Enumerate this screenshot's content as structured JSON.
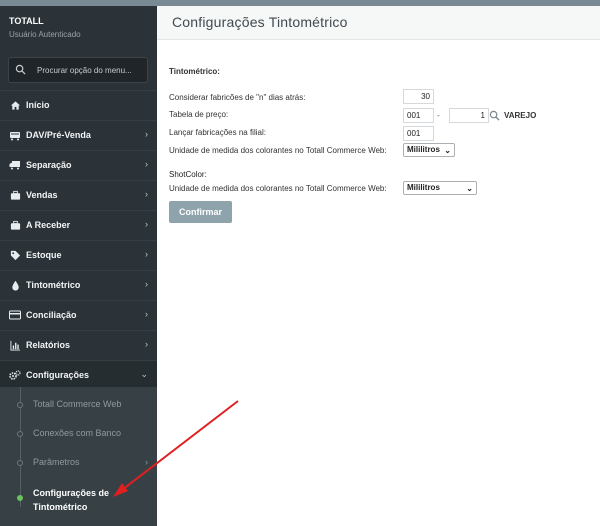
{
  "sidebar": {
    "brand": "TOTALL",
    "user_status": "Usuário Autenticado",
    "search_placeholder": "Procurar opção do menu...",
    "items": [
      {
        "label": "Início",
        "icon": "home-icon",
        "chevron": false
      },
      {
        "label": "DAV/Pré-Venda",
        "icon": "cart-icon",
        "chevron": true
      },
      {
        "label": "Separação",
        "icon": "truck-icon",
        "chevron": true
      },
      {
        "label": "Vendas",
        "icon": "briefcase-icon",
        "chevron": true
      },
      {
        "label": "A Receber",
        "icon": "briefcase-icon",
        "chevron": true
      },
      {
        "label": "Estoque",
        "icon": "tag-icon",
        "chevron": true
      },
      {
        "label": "Tintométrico",
        "icon": "drop-icon",
        "chevron": true
      },
      {
        "label": "Conciliação",
        "icon": "credit-card-icon",
        "chevron": true
      },
      {
        "label": "Relatórios",
        "icon": "bar-chart-icon",
        "chevron": true
      },
      {
        "label": "Configurações",
        "icon": "gears-icon",
        "chevron": true
      }
    ],
    "submenu": [
      {
        "label": "Totall Commerce Web"
      },
      {
        "label": "Conexões com Banco"
      },
      {
        "label": "Parâmetros"
      },
      {
        "label": "Configurações de Tintométrico",
        "line1": "Configurações de",
        "line2": "Tintométrico"
      }
    ]
  },
  "main": {
    "title": "Configurações Tintométrico",
    "tintometrico": {
      "section_label": "Tintométrico:",
      "days_label": "Considerar fabricões de \"n\" dias atrás:",
      "days_value": "30",
      "price_table_label": "Tabela de preço:",
      "price_table_from": "001",
      "price_table_to": "1",
      "price_table_name": "VAREJO",
      "branch_label": "Lançar fabricações na filial:",
      "branch_value": "001",
      "unit_label": "Unidade de medida dos colorantes no Totall Commerce Web:",
      "unit_value": "Mililitros"
    },
    "shotcolor": {
      "section_label": "ShotColor:",
      "unit_label": "Unidade de medida dos colorantes no Totall Commerce Web:",
      "unit_value": "Mililitros"
    },
    "confirm_label": "Confirmar"
  },
  "annotation": {
    "arrow_color": "#e02020"
  }
}
